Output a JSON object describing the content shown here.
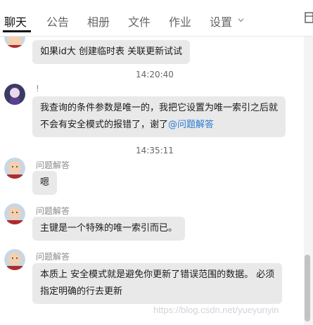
{
  "tabs": [
    {
      "label": "聊天",
      "active": true
    },
    {
      "label": "公告"
    },
    {
      "label": "相册"
    },
    {
      "label": "文件"
    },
    {
      "label": "作业"
    },
    {
      "label": "设置"
    }
  ],
  "messages": {
    "m0": {
      "lines": [
        "如果id大  创建临时表 关联更新试试"
      ]
    },
    "t1": "14:20:40",
    "m1": {
      "sender": "!",
      "lines": [
        "我查询的条件参数是唯一的，我把它设置为唯一索引之后就",
        "不会有安全模式的报错了，谢了"
      ],
      "mention": "@问题解答"
    },
    "t2": "14:35:11",
    "m2": {
      "sender": "问题解答",
      "lines": [
        "嗯"
      ]
    },
    "m3": {
      "sender": "问题解答",
      "lines": [
        "主键是一个特殊的唯一索引而已。"
      ]
    },
    "m4": {
      "sender": "问题解答",
      "lines": [
        "本质上 安全模式就是避免你更新了错误范围的数据。 必须",
        "指定明确的行去更新"
      ]
    }
  },
  "watermark": "https://blog.csdn.net/yueyunyin",
  "icons": {
    "settings_dropdown": "chevron-down-icon",
    "avatar_user": "anime-avatar",
    "avatar_helper": "bald-cartoon-avatar"
  },
  "colors": {
    "bubble": "#e9e9e9",
    "mention": "#2a7ad2",
    "timestamp": "#666666",
    "sender": "#8a8a8a"
  }
}
